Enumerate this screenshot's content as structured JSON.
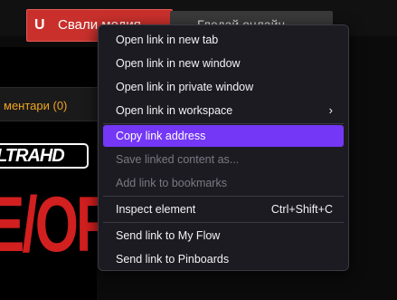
{
  "page": {
    "download_label": "Свали медия",
    "trailer_label": "Гледай онлайн",
    "comments_label": "ментари (0)",
    "uhd_logo_text": "LTRAHD",
    "poster_text": "E/OF"
  },
  "context_menu": {
    "items": [
      {
        "label": "Open link in new tab"
      },
      {
        "label": "Open link in new window"
      },
      {
        "label": "Open link in private window"
      },
      {
        "label": "Open link in workspace",
        "icon": "chevron-right-icon"
      },
      {
        "label": "Copy link address",
        "state": "highlighted"
      },
      {
        "label": "Save linked content as...",
        "state": "disabled"
      },
      {
        "label": "Add link to bookmarks",
        "state": "disabled"
      },
      {
        "label": "Inspect element",
        "shortcut": "Ctrl+Shift+C"
      },
      {
        "label": "Send link to My Flow"
      },
      {
        "label": "Send link to Pinboards"
      }
    ]
  },
  "colors": {
    "highlight": "#7437f6",
    "menu_background": "#1c1b22",
    "download_button": "#c9302c",
    "comments_link": "#f0a422",
    "poster_text": "#d21f1f"
  }
}
